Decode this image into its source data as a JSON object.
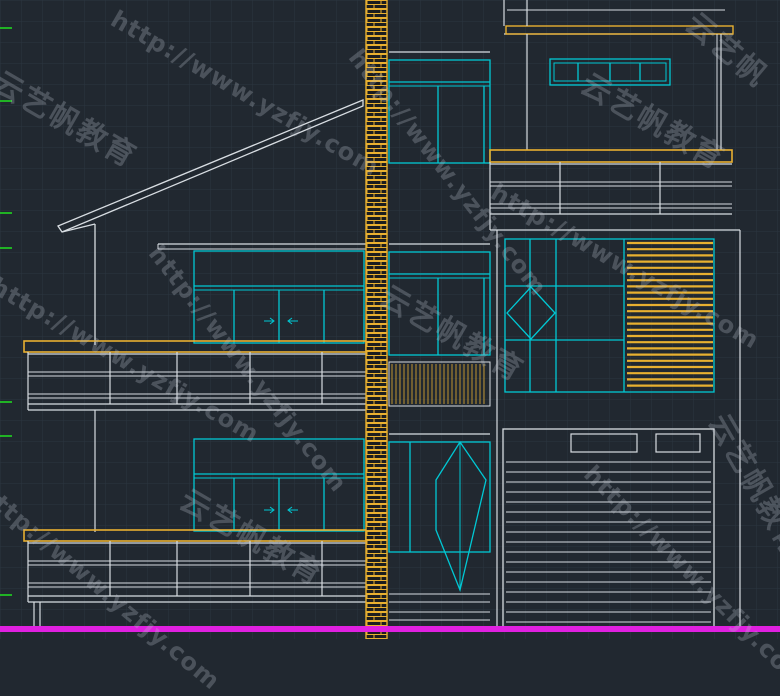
{
  "viewport": {
    "name": "CAD model space",
    "background": "#212830",
    "grid_color": "#2c3640"
  },
  "drawing": {
    "type": "building elevation",
    "colors": {
      "outline": "#d8dde2",
      "glazing": "#00c8d4",
      "slab_band": "#e8b030",
      "brick_hatch": "#e8b030",
      "ground_line": "#e020e0",
      "level_marker": "#20e020"
    }
  },
  "watermarks": [
    {
      "text": "云艺帆教育"
    },
    {
      "text": "http://www.yzfjy.com"
    }
  ]
}
